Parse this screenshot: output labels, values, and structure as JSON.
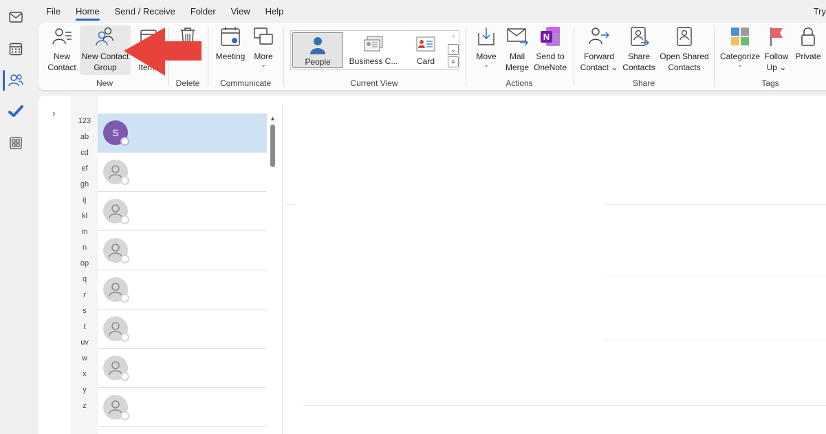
{
  "menu": {
    "items": [
      {
        "label": "File",
        "active": false
      },
      {
        "label": "Home",
        "active": true
      },
      {
        "label": "Send / Receive",
        "active": false
      },
      {
        "label": "Folder",
        "active": false
      },
      {
        "label": "View",
        "active": false
      },
      {
        "label": "Help",
        "active": false
      }
    ],
    "try_label": "Try"
  },
  "ribbon": {
    "new_contact": "New Contact",
    "new_contact_l1": "New",
    "new_contact_l2": "Contact",
    "new_group_l1": "New Contact",
    "new_group_l2": "Group",
    "new_items": "Items",
    "group_new": "New",
    "group_delete": "Delete",
    "meeting": "Meeting",
    "more": "More",
    "group_communicate": "Communicate",
    "view_people": "People",
    "view_business": "Business C...",
    "view_card": "Card",
    "group_current_view": "Current View",
    "move": "Move",
    "mail_merge_l1": "Mail",
    "mail_merge_l2": "Merge",
    "send_onenote_l1": "Send to",
    "send_onenote_l2": "OneNote",
    "group_actions": "Actions",
    "forward_l1": "Forward",
    "forward_l2": "Contact",
    "share_l1": "Share",
    "share_l2": "Contacts",
    "open_shared_l1": "Open Shared",
    "open_shared_l2": "Contacts",
    "group_share": "Share",
    "categorize": "Categorize",
    "follow_l1": "Follow",
    "follow_l2": "Up",
    "private": "Private",
    "group_tags": "Tags"
  },
  "alphabet": [
    "123",
    "ab",
    "cd",
    "ef",
    "gh",
    "ij",
    "kl",
    "m",
    "n",
    "op",
    "q",
    "r",
    "s",
    "t",
    "uv",
    "w",
    "x",
    "y",
    "z"
  ],
  "contacts": [
    {
      "initial": "S",
      "selected": true
    },
    {
      "initial": "",
      "selected": false
    },
    {
      "initial": "",
      "selected": false
    },
    {
      "initial": "",
      "selected": false
    },
    {
      "initial": "",
      "selected": false
    },
    {
      "initial": "",
      "selected": false
    },
    {
      "initial": "",
      "selected": false
    },
    {
      "initial": "",
      "selected": false
    }
  ],
  "colors": {
    "accent": "#2b69c7",
    "selected_row": "#cfe2f3",
    "avatar_s": "#7f59ae",
    "annotation_arrow": "#e8433a"
  }
}
